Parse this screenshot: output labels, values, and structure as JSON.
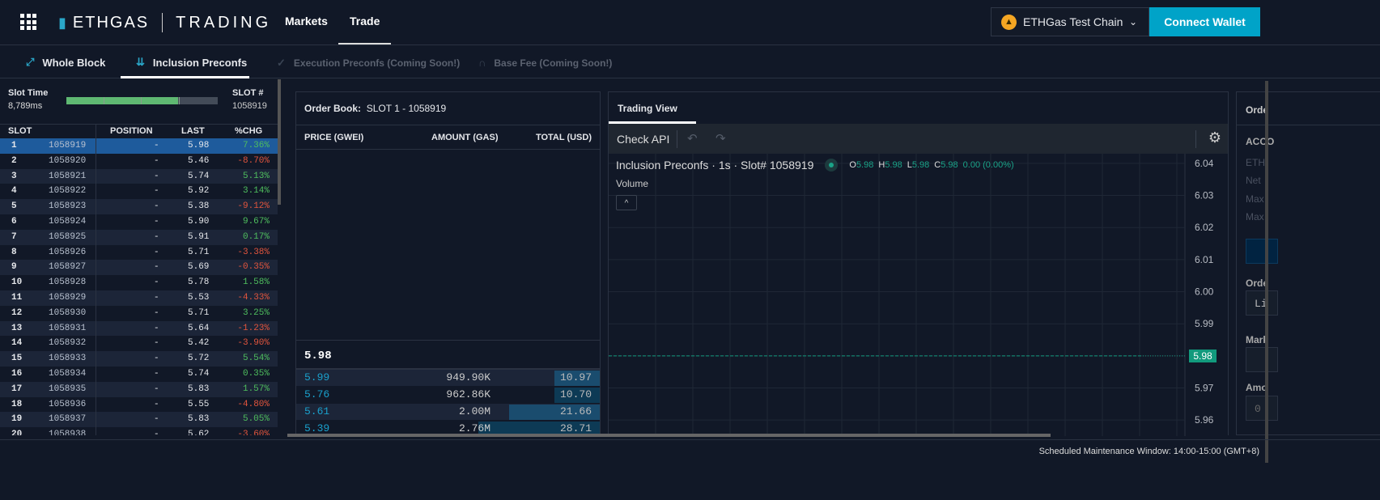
{
  "header": {
    "brand": "ETHGAS",
    "product": "TRADING",
    "nav": [
      "Markets",
      "Trade"
    ],
    "active_nav": "Trade",
    "chain": "ETHGas Test Chain",
    "connect": "Connect Wallet"
  },
  "subnav": [
    {
      "label": "Whole Block",
      "icon": "diagonal-arrows-icon",
      "enabled": true
    },
    {
      "label": "Inclusion Preconfs",
      "icon": "down-arrows-icon",
      "enabled": true,
      "active": true
    },
    {
      "label": "Execution Preconfs (Coming Soon!)",
      "icon": "check-icon",
      "enabled": false
    },
    {
      "label": "Base Fee (Coming Soon!)",
      "icon": "arch-icon",
      "enabled": false
    }
  ],
  "slot": {
    "time_label": "Slot Time",
    "time_value": "8,789ms",
    "progress": 0.74,
    "num_label": "SLOT #",
    "num_value": "1058919"
  },
  "slot_table": {
    "headers": [
      "SLOT",
      "POSITION",
      "LAST",
      "%CHG"
    ],
    "rows": [
      [
        "1",
        "1058919",
        "-",
        "5.98",
        "7.36%"
      ],
      [
        "2",
        "1058920",
        "-",
        "5.46",
        "-8.70%"
      ],
      [
        "3",
        "1058921",
        "-",
        "5.74",
        "5.13%"
      ],
      [
        "4",
        "1058922",
        "-",
        "5.92",
        "3.14%"
      ],
      [
        "5",
        "1058923",
        "-",
        "5.38",
        "-9.12%"
      ],
      [
        "6",
        "1058924",
        "-",
        "5.90",
        "9.67%"
      ],
      [
        "7",
        "1058925",
        "-",
        "5.91",
        "0.17%"
      ],
      [
        "8",
        "1058926",
        "-",
        "5.71",
        "-3.38%"
      ],
      [
        "9",
        "1058927",
        "-",
        "5.69",
        "-0.35%"
      ],
      [
        "10",
        "1058928",
        "-",
        "5.78",
        "1.58%"
      ],
      [
        "11",
        "1058929",
        "-",
        "5.53",
        "-4.33%"
      ],
      [
        "12",
        "1058930",
        "-",
        "5.71",
        "3.25%"
      ],
      [
        "13",
        "1058931",
        "-",
        "5.64",
        "-1.23%"
      ],
      [
        "14",
        "1058932",
        "-",
        "5.42",
        "-3.90%"
      ],
      [
        "15",
        "1058933",
        "-",
        "5.72",
        "5.54%"
      ],
      [
        "16",
        "1058934",
        "-",
        "5.74",
        "0.35%"
      ],
      [
        "17",
        "1058935",
        "-",
        "5.83",
        "1.57%"
      ],
      [
        "18",
        "1058936",
        "-",
        "5.55",
        "-4.80%"
      ],
      [
        "19",
        "1058937",
        "-",
        "5.83",
        "5.05%"
      ],
      [
        "20",
        "1058938",
        "-",
        "5.62",
        "-3.60%"
      ]
    ]
  },
  "orderbook": {
    "title_label": "Order Book:",
    "title_value": "SLOT 1 - 1058919",
    "headers": [
      "PRICE (GWEI)",
      "AMOUNT (GAS)",
      "TOTAL (USD)"
    ],
    "last_price": "5.98",
    "rows": [
      {
        "price": "5.99",
        "amount": "949.90K",
        "total": "10.97",
        "depth": 0.15
      },
      {
        "price": "5.76",
        "amount": "962.86K",
        "total": "10.70",
        "depth": 0.15
      },
      {
        "price": "5.61",
        "amount": "2.00M",
        "total": "21.66",
        "depth": 0.3
      },
      {
        "price": "5.39",
        "amount": "2.76M",
        "total": "28.71",
        "depth": 0.4
      }
    ]
  },
  "trading_view": {
    "tab": "Trading View",
    "check_api": "Check API",
    "legend_title": "Inclusion Preconfs · 1s · Slot# 1058919",
    "ohlc": {
      "O": "5.98",
      "H": "5.98",
      "L": "5.98",
      "C": "5.98",
      "change": "0.00 (0.00%)"
    },
    "volume": "Volume",
    "volume_toggle": "^",
    "current_price": "5.98",
    "up_color": "#129a7d"
  },
  "chart_data": {
    "type": "line",
    "y_ticks": [
      "6.04",
      "6.03",
      "6.02",
      "6.01",
      "6.00",
      "5.99",
      "5.98",
      "5.97",
      "5.96"
    ],
    "ylim": [
      5.955,
      6.043
    ],
    "series": [
      {
        "values": [
          5.98
        ]
      }
    ],
    "grid": true
  },
  "right_panel": {
    "title": "Orde",
    "labels": [
      "ACCO",
      "ETH",
      "Net",
      "Max",
      "Max"
    ],
    "order_label": "Orde",
    "order_value": "Li",
    "market_label": "Mark",
    "amount_label": "Amo",
    "amount_value": "0"
  },
  "footer": {
    "maintenance": "Scheduled Maintenance Window: 14:00-15:00 (GMT+8)"
  }
}
